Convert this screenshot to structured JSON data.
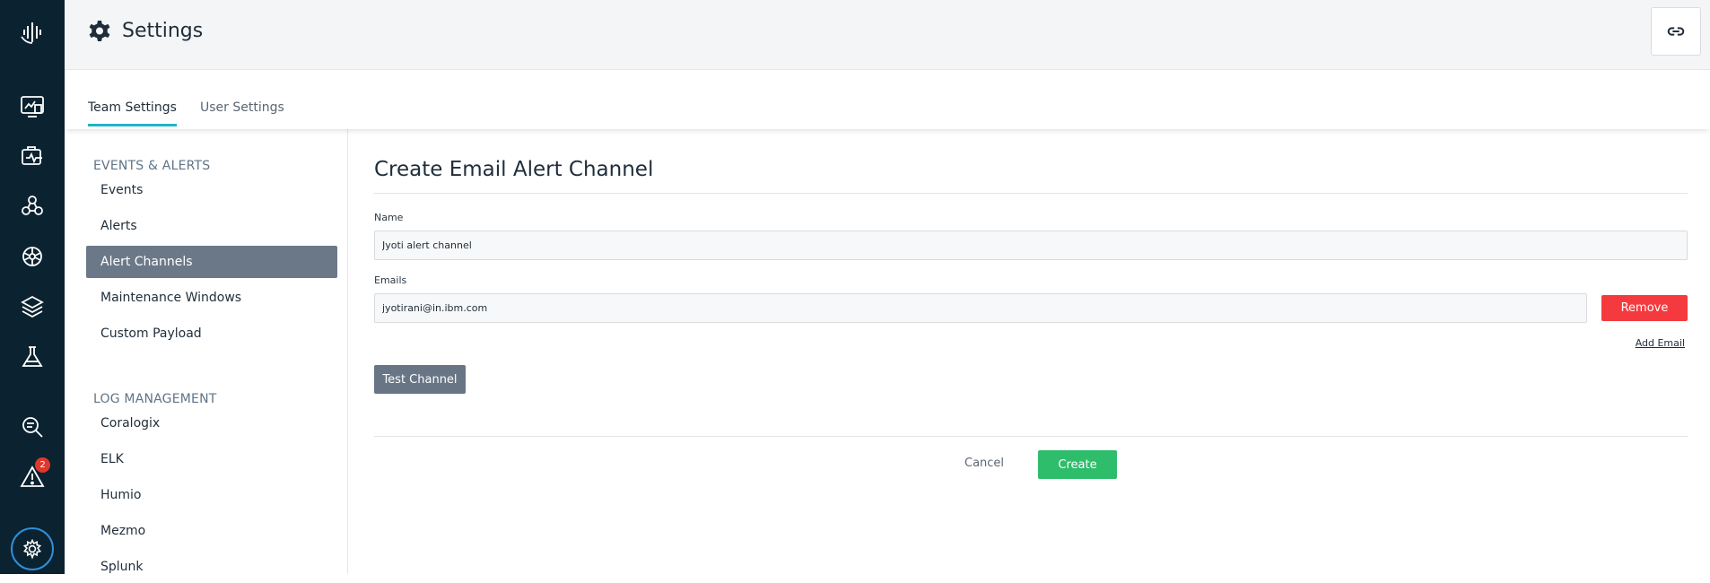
{
  "rail": {
    "badge_count": "2",
    "icons": [
      "logo-icon",
      "dashboard-icon",
      "monitoring-icon",
      "topology-icon",
      "kubernetes-icon",
      "layers-icon",
      "lab-icon",
      "analyze-icon",
      "alert-icon",
      "settings-icon"
    ]
  },
  "header": {
    "title": "Settings"
  },
  "tabs": [
    {
      "label": "Team Settings",
      "active": true
    },
    {
      "label": "User Settings",
      "active": false
    }
  ],
  "sidenav": {
    "sections": [
      {
        "title": "EVENTS & ALERTS",
        "items": [
          "Events",
          "Alerts",
          "Alert Channels",
          "Maintenance Windows",
          "Custom Payload"
        ]
      },
      {
        "title": "LOG MANAGEMENT",
        "items": [
          "Coralogix",
          "ELK",
          "Humio",
          "Mezmo",
          "Splunk"
        ]
      }
    ],
    "active_item": "Alert Channels"
  },
  "form": {
    "title": "Create Email Alert Channel",
    "name_label": "Name",
    "name_value": "Jyoti alert channel",
    "emails_label": "Emails",
    "email_value": "jyotirani@in.ibm.com",
    "remove_label": "Remove",
    "add_email_label": "Add Email",
    "test_label": "Test Channel",
    "cancel_label": "Cancel",
    "create_label": "Create"
  },
  "colors": {
    "rail": "#0b2230",
    "accent_tab": "#20b4c8",
    "remove": "#f43a3f",
    "create": "#2ebd6b",
    "active_nav": "#6b7888"
  }
}
